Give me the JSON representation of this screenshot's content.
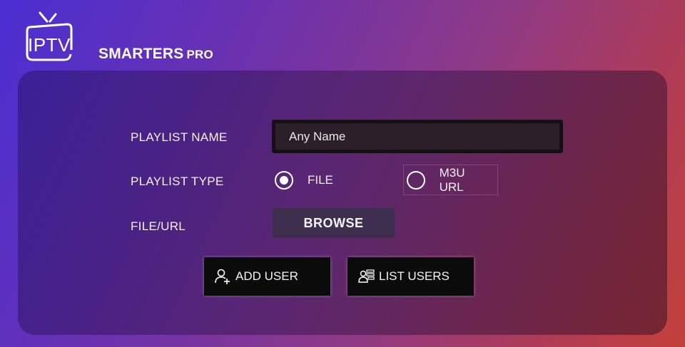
{
  "logo": {
    "iptv": "IPTV",
    "smarters": "SMARTERS",
    "pro": "PRO"
  },
  "form": {
    "playlist_name_label": "PLAYLIST NAME",
    "playlist_name_value": "Any Name",
    "playlist_type_label": "PLAYLIST TYPE",
    "type_options": [
      {
        "label": "FILE",
        "selected": true
      },
      {
        "label": "M3U URL",
        "selected": false
      }
    ],
    "file_url_label": "FILE/URL",
    "browse_label": "BROWSE"
  },
  "actions": {
    "add_user_label": "ADD USER",
    "list_users_label": "LIST USERS"
  },
  "colors": {
    "highlight_border": "#e0262b",
    "button_bg": "#0c0b0c",
    "browse_bg": "#3f2f4e"
  }
}
